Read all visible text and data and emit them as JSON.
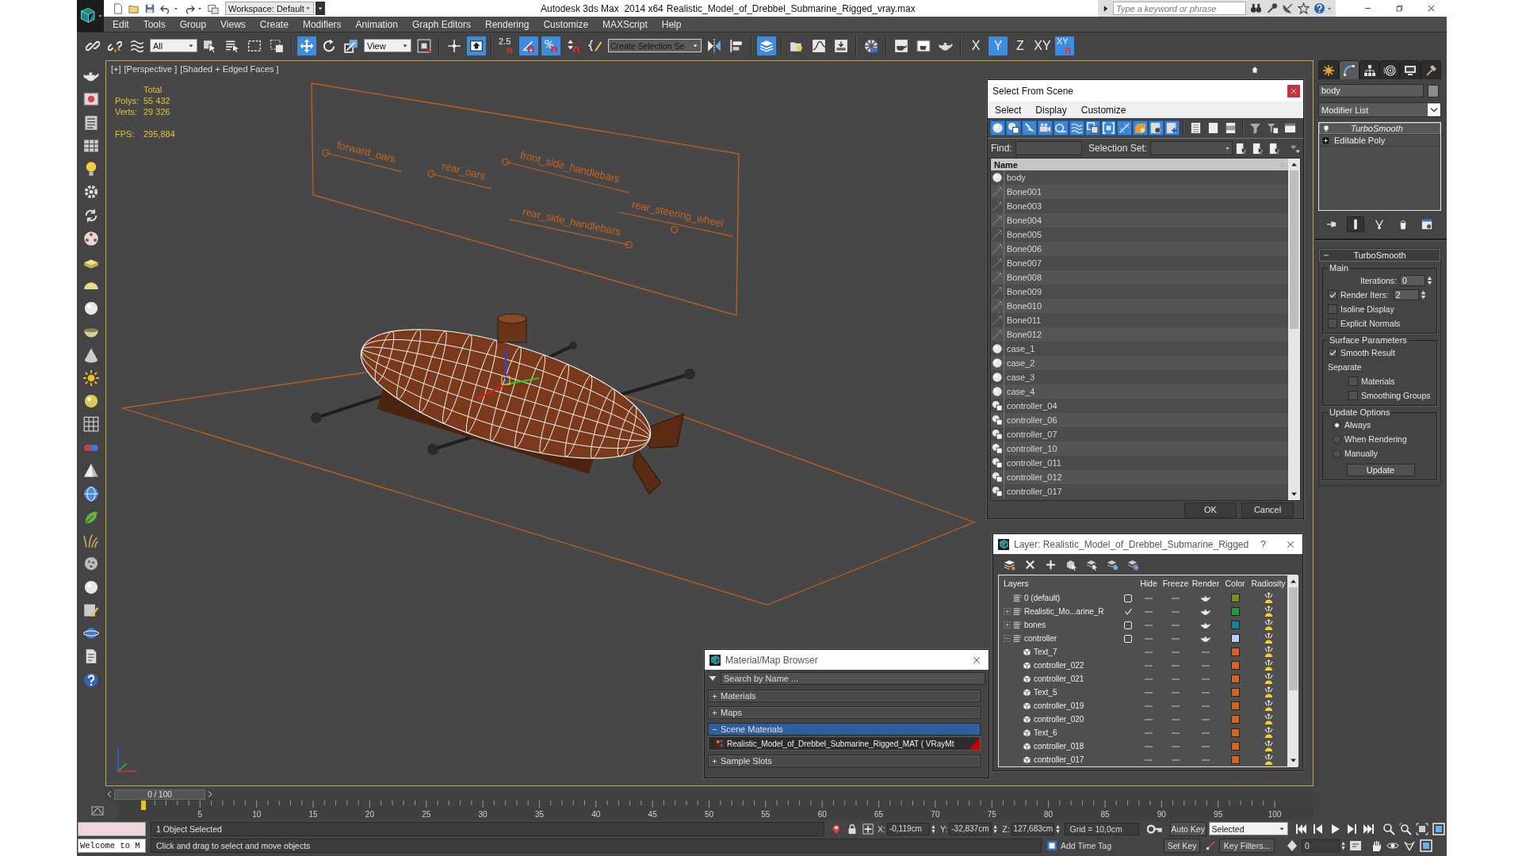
{
  "title_bar": {
    "workspace": "Workspace: Default",
    "app_title": "Autodesk 3ds Max  2014 x64",
    "file_name": "Realistic_Model_of_Drebbel_Submarine_Rigged_vray.max",
    "search": {
      "placeholder": "Type a keyword or phrase"
    }
  },
  "menu_bar": [
    "Edit",
    "Tools",
    "Group",
    "Views",
    "Create",
    "Modifiers",
    "Animation",
    "Graph Editors",
    "Rendering",
    "Customize",
    "MAXScript",
    "Help"
  ],
  "main_toolbar": [
    [
      {
        "kind": "icon",
        "selected": false
      },
      {
        "kind": "icon",
        "selected": false
      },
      {
        "kind": "icon",
        "selected": false
      },
      {
        "kind": "dropdown",
        "value": "All"
      },
      {
        "kind": "icon",
        "selected": false
      },
      {
        "kind": "icon",
        "selected": false
      },
      {
        "kind": "icon",
        "selected": false
      },
      {
        "kind": "icon",
        "selected": false
      }
    ],
    [
      {
        "kind": "icon",
        "selected": true
      },
      {
        "kind": "icon",
        "selected": false
      },
      {
        "kind": "icon",
        "selected": false
      },
      {
        "kind": "dropdown",
        "value": "View"
      },
      {
        "kind": "icon",
        "selected": false
      }
    ],
    [
      {
        "kind": "icon",
        "selected": false
      },
      {
        "kind": "icon",
        "selected": true
      }
    ],
    [
      {
        "kind": "snap_text",
        "label": "2.5",
        "selected": false
      },
      {
        "kind": "icon",
        "selected": true
      },
      {
        "kind": "icon",
        "selected": true
      },
      {
        "kind": "icon",
        "selected": false
      },
      {
        "kind": "icon",
        "selected": false
      },
      {
        "kind": "combo",
        "placeholder": "Create Selection Se"
      },
      {
        "kind": "icon",
        "selected": false
      },
      {
        "kind": "icon",
        "selected": false
      }
    ],
    [
      {
        "kind": "icon",
        "selected": true
      }
    ],
    [
      {
        "kind": "icon",
        "selected": false
      },
      {
        "kind": "icon",
        "selected": false
      },
      {
        "kind": "icon",
        "selected": false
      }
    ],
    [
      {
        "kind": "icon",
        "selected": false
      }
    ],
    [
      {
        "kind": "icon",
        "selected": false
      },
      {
        "kind": "icon",
        "selected": false
      },
      {
        "kind": "icon",
        "selected": false
      }
    ],
    [
      {
        "kind": "text",
        "label": "X",
        "selected": false
      },
      {
        "kind": "text",
        "label": "Y",
        "selected": true
      },
      {
        "kind": "text",
        "label": "Z",
        "selected": false
      },
      {
        "kind": "text",
        "label": "XY",
        "selected": false
      },
      {
        "kind": "snap_text",
        "label": "XY",
        "selected": true
      }
    ]
  ],
  "viewport": {
    "labels": [
      "[+]",
      "[Perspective ]",
      "[Shaded + Edged Faces ]"
    ],
    "stats": {
      "heading": "Total",
      "rows": [
        {
          "label": "Polys:",
          "value": "55 432"
        },
        {
          "label": "Verts:",
          "value": "29 326"
        },
        {
          "label": "FPS:",
          "value": "295,884"
        }
      ]
    },
    "scene_labels": [
      "forward_oars",
      "rear_oars",
      "front_side_handlebars",
      "rear_side_handlebars",
      "rear_steering_wheel"
    ]
  },
  "select_from_scene": {
    "title": "Select From Scene",
    "menu": [
      "Select",
      "Display",
      "Customize"
    ],
    "filters": [
      {
        "selected": true
      },
      {
        "selected": true
      },
      {
        "selected": true
      },
      {
        "selected": true
      },
      {
        "selected": true
      },
      {
        "selected": true
      },
      {
        "selected": true
      },
      {
        "selected": true
      },
      {
        "selected": true
      },
      {
        "selected": true
      },
      {
        "selected": true
      },
      {
        "selected": true
      }
    ],
    "find_label": "Find:",
    "selection_set_label": "Selection Set:",
    "column": "Name",
    "rows": [
      {
        "name": "body",
        "kind": "geometry",
        "selected": false
      },
      {
        "name": "Bone001",
        "kind": "bone",
        "selected": false
      },
      {
        "name": "Bone003",
        "kind": "bone",
        "selected": false
      },
      {
        "name": "Bone004",
        "kind": "bone",
        "selected": false
      },
      {
        "name": "Bone005",
        "kind": "bone",
        "selected": false
      },
      {
        "name": "Bone006",
        "kind": "bone",
        "selected": false
      },
      {
        "name": "Bone007",
        "kind": "bone",
        "selected": false
      },
      {
        "name": "Bone008",
        "kind": "bone",
        "selected": false
      },
      {
        "name": "Bone009",
        "kind": "bone",
        "selected": false
      },
      {
        "name": "Bone010",
        "kind": "bone",
        "selected": false
      },
      {
        "name": "Bone011",
        "kind": "bone",
        "selected": false
      },
      {
        "name": "Bone012",
        "kind": "bone",
        "selected": false
      },
      {
        "name": "case_1",
        "kind": "geometry",
        "selected": false
      },
      {
        "name": "case_2",
        "kind": "geometry",
        "selected": false
      },
      {
        "name": "case_3",
        "kind": "geometry",
        "selected": false
      },
      {
        "name": "case_4",
        "kind": "geometry",
        "selected": false
      },
      {
        "name": "controller_04",
        "kind": "shape",
        "selected": false
      },
      {
        "name": "controller_06",
        "kind": "shape",
        "selected": false
      },
      {
        "name": "controller_07",
        "kind": "shape",
        "selected": false
      },
      {
        "name": "controller_10",
        "kind": "shape",
        "selected": false
      },
      {
        "name": "controller_011",
        "kind": "shape",
        "selected": false
      },
      {
        "name": "controller_012",
        "kind": "shape",
        "selected": false
      },
      {
        "name": "controller_017",
        "kind": "shape",
        "selected": false
      }
    ],
    "buttons": [
      "OK",
      "Cancel"
    ]
  },
  "material_browser": {
    "title": "Material/Map Browser",
    "search": {
      "placeholder": "Search by Name ..."
    },
    "groups": [
      {
        "label": "Materials",
        "expanded": false,
        "selected": false
      },
      {
        "label": "Maps",
        "expanded": false,
        "selected": false
      },
      {
        "label": "Scene Materials",
        "expanded": true,
        "selected": true,
        "items": [
          "Realistic_Model_of_Drebbel_Submarine_Rigged_MAT ( VRayMt"
        ]
      },
      {
        "label": "Sample Slots",
        "expanded": false,
        "selected": false
      }
    ]
  },
  "layer_manager": {
    "title": "Layer: Realistic_Model_of_Drebbel_Submarine_Rigged",
    "help": "?",
    "columns": [
      "Layers",
      "Hide",
      "Freeze",
      "Render",
      "Color",
      "Radiosity"
    ],
    "layers": [
      {
        "name": "0 (default)",
        "current": false,
        "hidden": false,
        "frozen": false,
        "color": "#74901a"
      },
      {
        "name": "Realistic_Mo...arine_R",
        "expanded": false,
        "current": true,
        "hidden": false,
        "frozen": false,
        "color": "#1e9c3e"
      },
      {
        "name": "bones",
        "expanded": false,
        "current": false,
        "hidden": false,
        "frozen": false,
        "color": "#17829a"
      },
      {
        "name": "controller",
        "expanded": true,
        "current": false,
        "hidden": false,
        "frozen": false,
        "color": "#b6cff2",
        "children": [
          {
            "name": "Text_7",
            "hidden": false,
            "frozen": false,
            "color": "#d4641e"
          },
          {
            "name": "controller_022",
            "hidden": false,
            "frozen": false,
            "color": "#d4641e"
          },
          {
            "name": "controller_021",
            "hidden": false,
            "frozen": false,
            "color": "#d4641e"
          },
          {
            "name": "Text_5",
            "hidden": false,
            "frozen": false,
            "color": "#d4641e"
          },
          {
            "name": "controller_019",
            "hidden": false,
            "frozen": false,
            "color": "#d4641e"
          },
          {
            "name": "controller_020",
            "hidden": false,
            "frozen": false,
            "color": "#d4641e"
          },
          {
            "name": "Text_6",
            "hidden": false,
            "frozen": false,
            "color": "#d4641e"
          },
          {
            "name": "controller_018",
            "hidden": false,
            "frozen": false,
            "color": "#d4641e"
          },
          {
            "name": "controller_017",
            "hidden": false,
            "frozen": false,
            "color": "#d4641e"
          }
        ]
      }
    ]
  },
  "command_panel": {
    "tabs": [
      {
        "selected": false
      },
      {
        "selected": true
      },
      {
        "selected": false
      },
      {
        "selected": false
      },
      {
        "selected": false
      },
      {
        "selected": false
      }
    ],
    "object_name": "body",
    "modifier_list": "Modifier List",
    "stack": [
      {
        "name": "TurboSmooth",
        "kind": "modifier",
        "selected": true
      },
      {
        "name": "Editable Poly",
        "kind": "base_object",
        "selected": false
      }
    ],
    "stack_tools": [
      {
        "selected": false
      },
      {
        "selected": true
      },
      {
        "selected": false
      },
      {
        "selected": false
      },
      {
        "selected": false
      }
    ],
    "rollout": {
      "title": "TurboSmooth",
      "expanded": true,
      "groups": [
        {
          "title": "Main",
          "controls": [
            {
              "kind": "spinner",
              "label": "Iterations:",
              "value": "0"
            },
            {
              "kind": "check_spinner",
              "label": "Render Iters:",
              "checked": true,
              "value": "2"
            },
            {
              "kind": "checkbox",
              "label": "Isoline Display",
              "checked": false
            },
            {
              "kind": "checkbox",
              "label": "Explicit Normals",
              "checked": false
            }
          ]
        },
        {
          "title": "Surface Parameters",
          "controls": [
            {
              "kind": "checkbox",
              "label": "Smooth Result",
              "checked": true
            },
            {
              "kind": "label",
              "label": "Separate"
            },
            {
              "kind": "sub_checkbox",
              "label": "Materials",
              "checked": false
            },
            {
              "kind": "sub_checkbox",
              "label": "Smoothing Groups",
              "checked": false
            }
          ]
        },
        {
          "title": "Update Options",
          "controls": [
            {
              "kind": "radio",
              "label": "Always",
              "selected": true
            },
            {
              "kind": "radio",
              "label": "When Rendering",
              "selected": false
            },
            {
              "kind": "radio",
              "label": "Manually",
              "selected": false
            },
            {
              "kind": "button",
              "label": "Update"
            }
          ]
        }
      ]
    }
  },
  "time_slider": {
    "label": "0 / 100",
    "level": 0
  },
  "track_bar": {
    "labels": [
      "5",
      "10",
      "15",
      "20",
      "25",
      "30",
      "35",
      "40",
      "45",
      "50",
      "55",
      "60",
      "65",
      "70",
      "75",
      "80",
      "85",
      "90",
      "95",
      "100"
    ]
  },
  "status_bar": {
    "listener_output": "Welcome to M",
    "selection": "1 Object Selected",
    "prompt": "Click and drag to select and move objects",
    "coordinates": [
      {
        "label": "X:",
        "value": "-0,119cm"
      },
      {
        "label": "Y:",
        "value": "-32,837cm"
      },
      {
        "label": "Z:",
        "value": "127,683cm"
      }
    ],
    "grid": "Grid = 10,0cm",
    "add_time_tag": "Add Time Tag"
  },
  "animation_controls": {
    "auto_key": {
      "label": "Auto Key",
      "on": false
    },
    "key_mode": "Selected",
    "set_key": "Set Key",
    "key_filters": "Key Filters...",
    "frame": "0"
  }
}
